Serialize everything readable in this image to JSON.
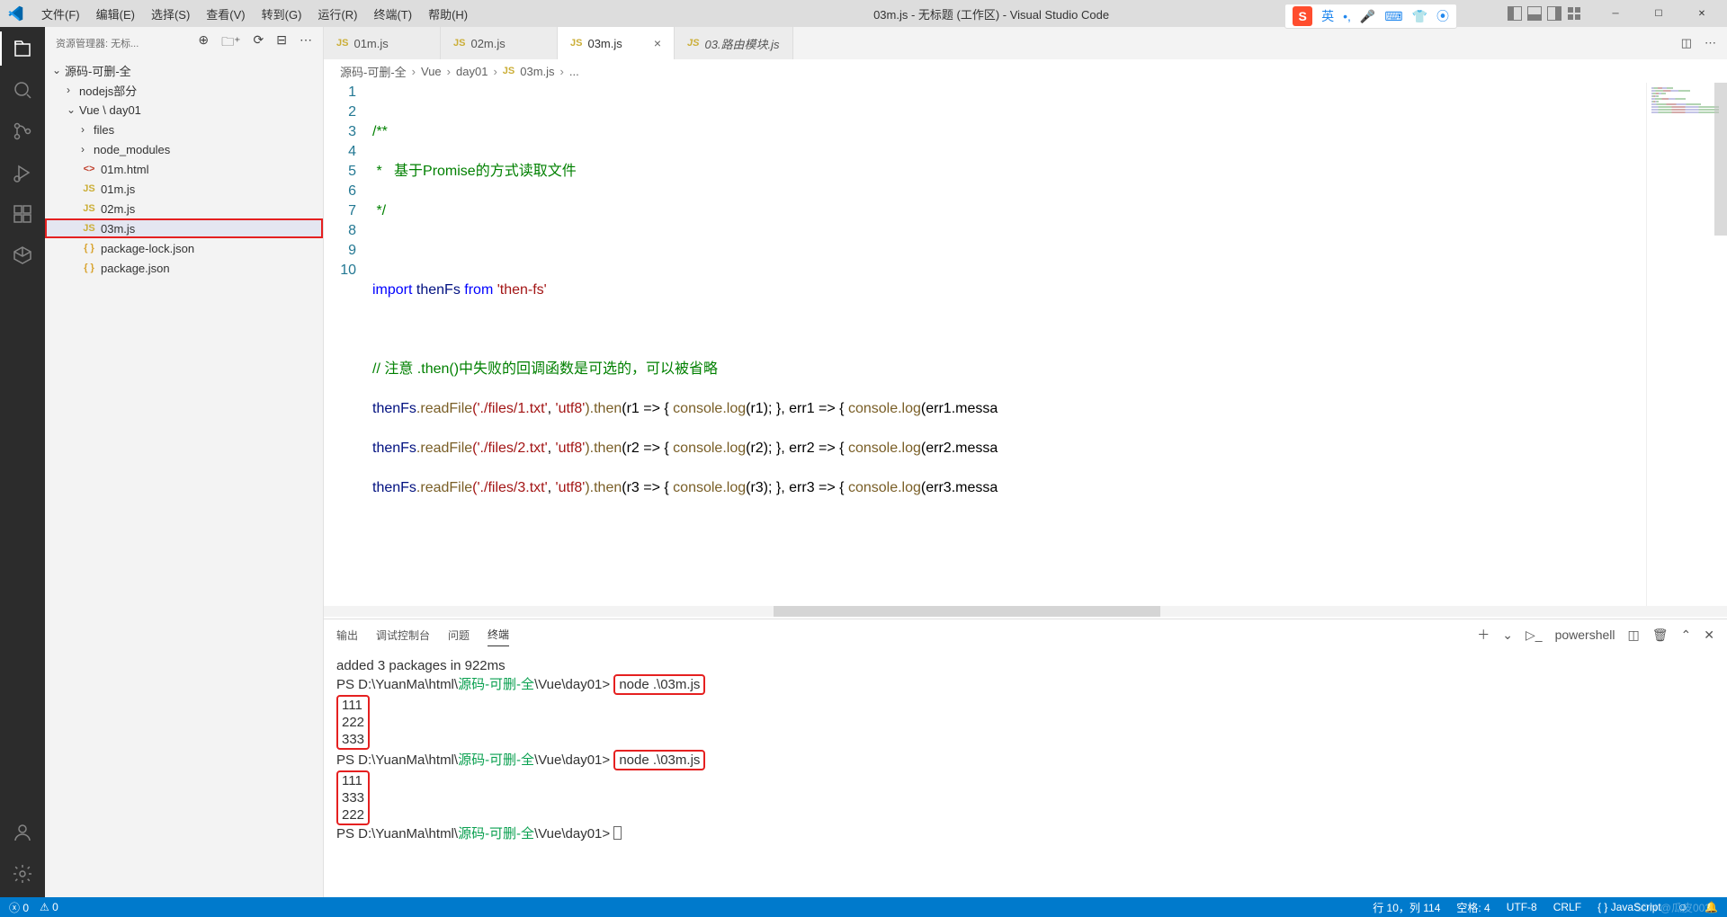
{
  "menu": [
    "文件(F)",
    "编辑(E)",
    "选择(S)",
    "查看(V)",
    "转到(G)",
    "运行(R)",
    "终端(T)",
    "帮助(H)"
  ],
  "title": "03m.js - 无标题 (工作区) - Visual Studio Code",
  "ime": {
    "lang": "英"
  },
  "sidebar": {
    "title": "资源管理器: 无标...",
    "root": "源码-可删-全",
    "nodejs": "nodejs部分",
    "vue": "Vue \\ day01",
    "files": "files",
    "node_modules": "node_modules",
    "items": [
      "01m.html",
      "01m.js",
      "02m.js",
      "03m.js",
      "package-lock.json",
      "package.json"
    ]
  },
  "tabs": [
    {
      "label": "01m.js",
      "icon": "JS"
    },
    {
      "label": "02m.js",
      "icon": "JS"
    },
    {
      "label": "03m.js",
      "icon": "JS",
      "active": true
    },
    {
      "label": "03.路由模块.js",
      "icon": "JS"
    }
  ],
  "breadcrumb": [
    "源码-可删-全",
    "Vue",
    "day01",
    "03m.js",
    "..."
  ],
  "code": {
    "l1": "/**",
    "l2_a": " *   基于",
    "l2_b": "Promise",
    "l2_c": "的方式读取文件",
    "l3": " */",
    "l5_import": "import",
    "l5_thenfs": " thenFs ",
    "l5_from": "from",
    "l5_str": " 'then-fs'",
    "l7_a": "// 注意 ",
    "l7_b": ".then()",
    "l7_c": "中失败的回调函数是可选的，可以被省略",
    "l8_a": "thenFs",
    "l8_read": ".readFile",
    "l8_s1": "('./files/1.txt'",
    "l8_c": ", ",
    "l8_s2": "'utf8'",
    "l8_then": ").then",
    "l8_arrow": "(r1 => { ",
    "l8_log": "console.log",
    "l8_arg": "(r1); }, err1 => { ",
    "l8_log2": "console.log",
    "l8_arg2": "(err1.messa",
    "l9_s1": "('./files/2.txt'",
    "l9_arrow": "(r2 => { ",
    "l9_arg": "(r2); }, err2 => { ",
    "l9_arg2": "(err2.messa",
    "l10_s1": "('./files/3.txt'",
    "l10_arrow": "(r3 => { ",
    "l10_arg": "(r3); }, err3 => { ",
    "l10_arg2": "(err3.messa"
  },
  "panel": {
    "tabs": [
      "输出",
      "调试控制台",
      "问题",
      "终端"
    ],
    "shell": "powershell",
    "added": "added 3 packages in 922ms",
    "ps_prefix": "PS D:\\YuanMa\\html\\",
    "ps_cn": "源码-可删-全",
    "ps_suffix": "\\Vue\\day01>",
    "node_cmd": "node .\\03m.js",
    "out1": [
      "111",
      "222",
      "333"
    ],
    "out2": [
      "111",
      "333",
      "222"
    ]
  },
  "status": {
    "errors": "0",
    "warnings": "0",
    "pos": "行 10，列 114",
    "spaces": "空格: 4",
    "encoding": "UTF-8",
    "eol": "CRLF",
    "lang": "{ } JavaScript",
    "notif": "瓜皮003",
    "watermark": "SDN @瓜皮003"
  }
}
